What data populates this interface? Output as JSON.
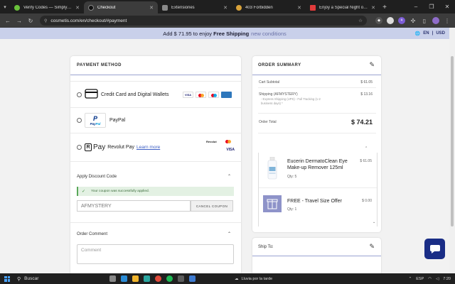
{
  "browser": {
    "tabs": [
      {
        "label": "Verify Codes — SimplyCodes",
        "active": false,
        "color": "#6ac23b"
      },
      {
        "label": "Checkout",
        "active": true,
        "color": "#111111"
      },
      {
        "label": "Extensiones",
        "active": false,
        "color": "#8a8a8a"
      },
      {
        "label": "403 Forbidden",
        "active": false,
        "color": "#d8a23a"
      },
      {
        "label": "Enjoy a Special Night of Duo ...",
        "active": false,
        "color": "#e23b3b"
      }
    ],
    "url": "cosmetis.com/en/checkout/#payment"
  },
  "promo": {
    "prefix": "Add",
    "amount": "$ 71.95",
    "middle": "to enjoy",
    "bold": "Free Shipping",
    "suffix": "new conditions"
  },
  "lang": {
    "language": "EN",
    "currency": "USD"
  },
  "payment": {
    "title": "PAYMENT METHOD",
    "options": [
      {
        "label": "Credit Card and Digital Wallets"
      },
      {
        "label": "PayPal"
      },
      {
        "label": "Revolut Pay",
        "link": "Learn more"
      }
    ],
    "card_logos": [
      "VISA",
      "MC",
      "MAESTRO",
      "AMEX"
    ],
    "revolut_tag": "Revolut"
  },
  "discount": {
    "title": "Apply Discount Code",
    "success": "Your coupon was successfully applied.",
    "code": "AFMYSTERY",
    "button": "CANCEL COUPON"
  },
  "comment": {
    "title": "Order Comment",
    "placeholder": "Comment"
  },
  "summary": {
    "title": "ORDER SUMMARY",
    "subtotal_label": "Cart Subtotal",
    "subtotal_value": "$ 61.05",
    "shipping_label": "Shipping (AFMYSTERY)",
    "shipping_value": "$ 13.16",
    "shipping_detail": "- Express Shipping (UPS) - Full Tracking (1-2 business days) *",
    "total_label": "Order Total",
    "total_value": "$ 74.21",
    "items": [
      {
        "name": "Eucerin DermatoClean Eye Make-up Remover 125ml",
        "qty": "Qty: 5",
        "price": "$ 61.05"
      },
      {
        "name": "FREE - Travel Size Offer",
        "qty": "Qty: 1",
        "price": "$ 0.00"
      }
    ]
  },
  "ship": {
    "title": "Ship To:"
  },
  "taskbar": {
    "search": "Buscar",
    "weather": "Lluvia por la tarde",
    "lang": "ESP",
    "time": "7:20"
  },
  "colors": {
    "accent": "#1a2d86",
    "promo_bg": "#c9d0ea",
    "line": "#9aa3d1"
  }
}
